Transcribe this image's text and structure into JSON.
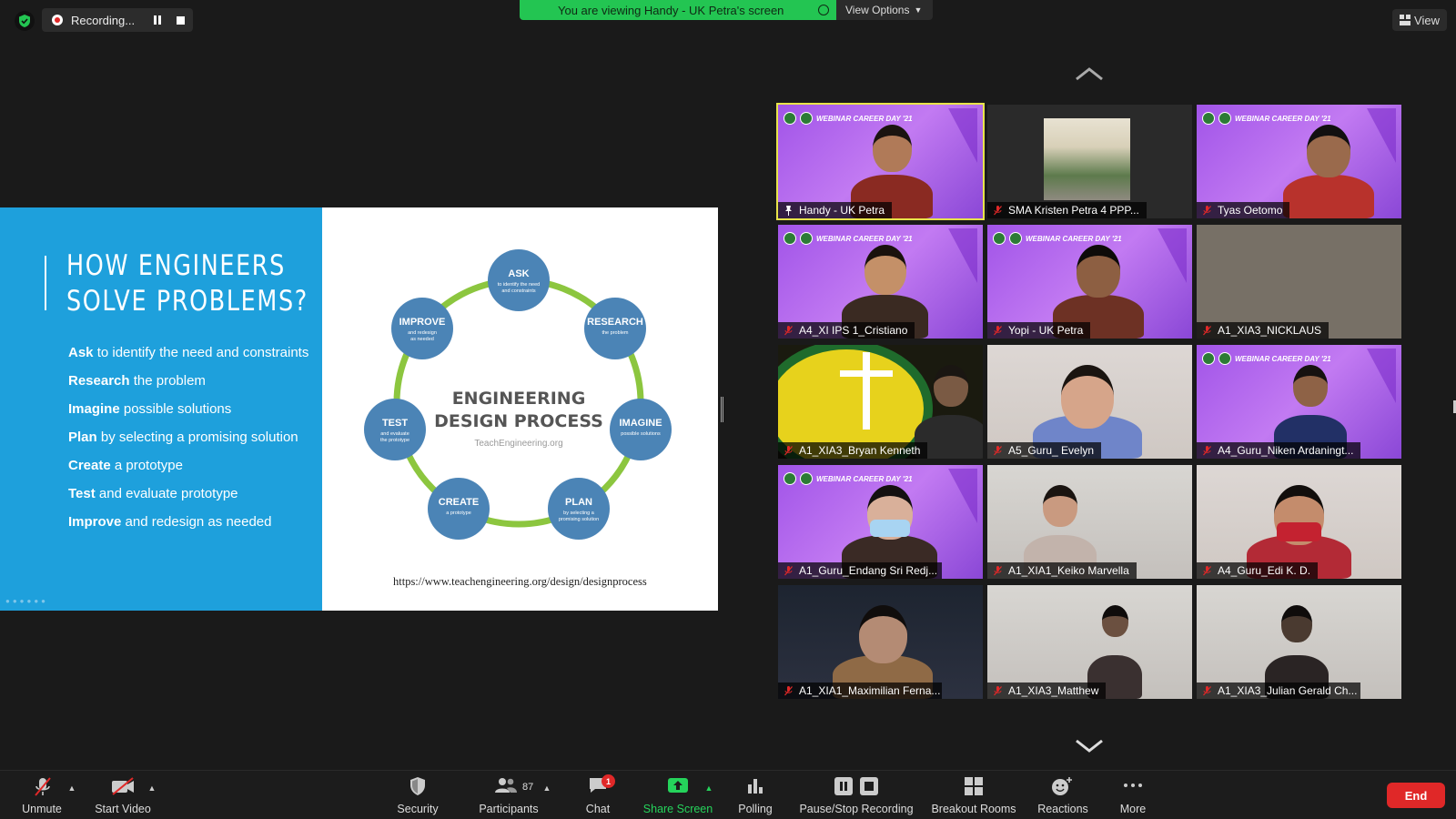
{
  "top": {
    "recording_label": "Recording...",
    "viewing_banner": "You are viewing Handy - UK Petra's screen",
    "view_options": "View Options",
    "view_button": "View"
  },
  "slide": {
    "title_line1": "HOW ENGINEERS",
    "title_line2": "SOLVE PROBLEMS?",
    "steps": [
      {
        "bold": "Ask",
        "text": " to identify the need and constraints"
      },
      {
        "bold": "Research",
        "text": " the problem"
      },
      {
        "bold": "Imagine",
        "text": " possible solutions"
      },
      {
        "bold": "Plan",
        "text": " by selecting a promising solution"
      },
      {
        "bold": "Create",
        "text": " a prototype"
      },
      {
        "bold": "Test",
        "text": " and evaluate prototype"
      },
      {
        "bold": "Improve",
        "text": " and redesign as needed"
      }
    ],
    "diagram_center_line1": "ENGINEERING",
    "diagram_center_line2": "DESIGN PROCESS",
    "diagram_center_source": "TeachEngineering.org",
    "nodes": [
      {
        "title": "ASK",
        "sub1": "to identify the need",
        "sub2": "and constraints"
      },
      {
        "title": "RESEARCH",
        "sub1": "the problem",
        "sub2": ""
      },
      {
        "title": "IMAGINE",
        "sub1": "possible solutions",
        "sub2": ""
      },
      {
        "title": "PLAN",
        "sub1": "by selecting a",
        "sub2": "promising solution"
      },
      {
        "title": "CREATE",
        "sub1": "a prototype",
        "sub2": ""
      },
      {
        "title": "TEST",
        "sub1": "and evaluate",
        "sub2": "the prototype"
      },
      {
        "title": "IMPROVE",
        "sub1": "and redesign",
        "sub2": "as needed"
      }
    ],
    "url": "https://www.teachengineering.org/design/designprocess"
  },
  "gallery": {
    "webinar_banner": "WEBINAR CAREER DAY '21",
    "participants": [
      {
        "name": "Handy - UK Petra",
        "muted": false
      },
      {
        "name": "SMA Kristen Petra 4 PPP...",
        "muted": true
      },
      {
        "name": "Tyas Oetomo",
        "muted": true
      },
      {
        "name": "A4_XI IPS 1_Cristiano",
        "muted": true
      },
      {
        "name": "Yopi - UK Petra",
        "muted": true
      },
      {
        "name": "A1_XIA3_NICKLAUS",
        "muted": true
      },
      {
        "name": "A1_XIA3_Bryan Kenneth",
        "muted": true
      },
      {
        "name": "A5_Guru_ Evelyn",
        "muted": true
      },
      {
        "name": "A4_Guru_Niken Ardaningt...",
        "muted": true
      },
      {
        "name": "A1_Guru_Endang Sri Redj...",
        "muted": true
      },
      {
        "name": "A1_XIA1_Keiko Marvella",
        "muted": true
      },
      {
        "name": "A4_Guru_Edi K. D.",
        "muted": true
      },
      {
        "name": "A1_XIA1_Maximilian Ferna...",
        "muted": true
      },
      {
        "name": "A1_XIA3_Matthew",
        "muted": true
      },
      {
        "name": "A1_XIA3_Julian Gerald Ch...",
        "muted": true
      }
    ]
  },
  "toolbar": {
    "unmute": "Unmute",
    "start_video": "Start Video",
    "security": "Security",
    "participants": "Participants",
    "participants_count": "87",
    "chat": "Chat",
    "chat_badge": "1",
    "share_screen": "Share Screen",
    "polling": "Polling",
    "pause_stop": "Pause/Stop Recording",
    "breakout": "Breakout Rooms",
    "reactions": "Reactions",
    "more": "More",
    "end": "End"
  },
  "colors": {
    "accent_green": "#23c552",
    "end_red": "#e02828",
    "slide_blue": "#1ea0dc",
    "diagram_node": "#4b84b6",
    "diagram_ring": "#8cc63f",
    "active_speaker": "#e8e44a"
  }
}
